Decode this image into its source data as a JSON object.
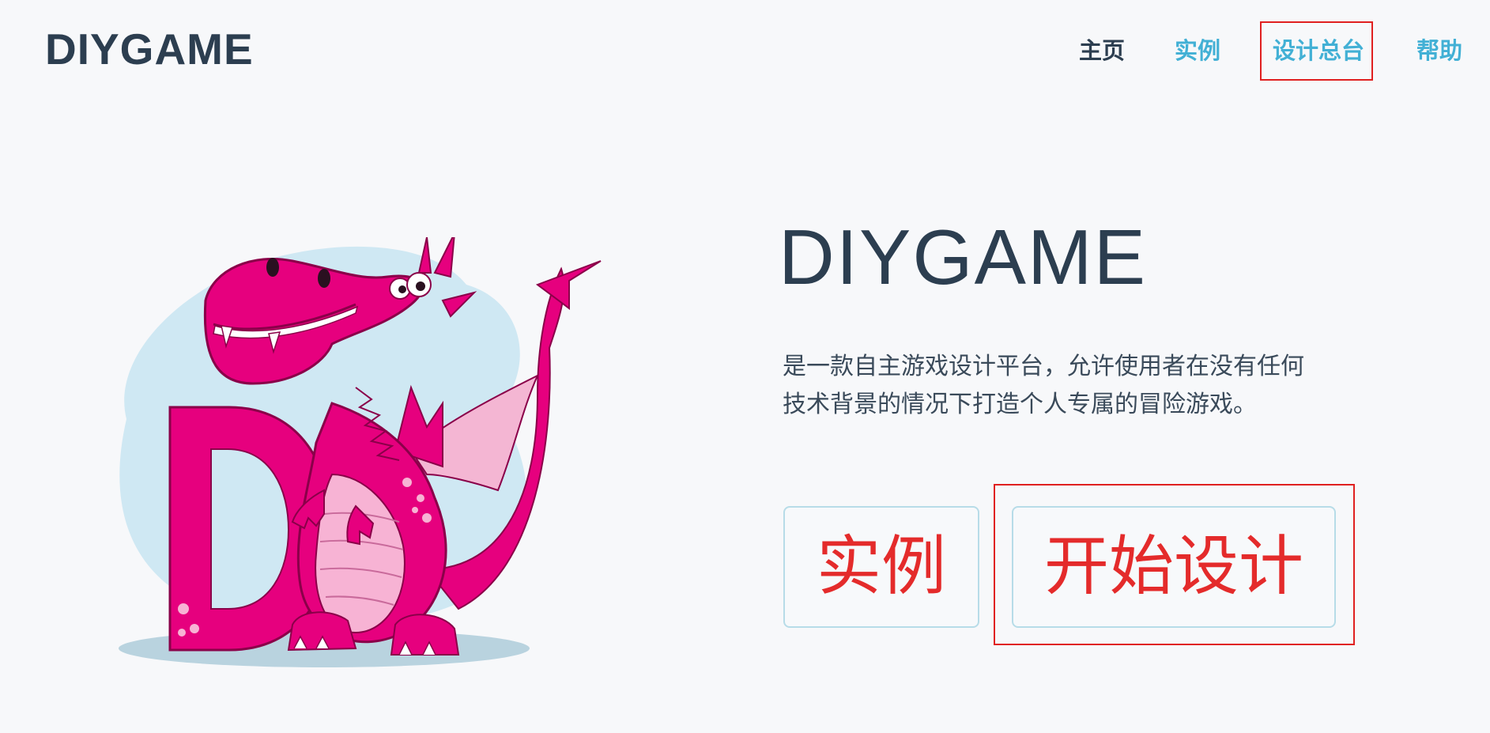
{
  "header": {
    "logo": "DIYGAME",
    "nav": [
      {
        "label": "主页"
      },
      {
        "label": "实例"
      },
      {
        "label": "设计总台"
      },
      {
        "label": "帮助"
      }
    ]
  },
  "hero": {
    "title": "DIYGAME",
    "description_line1": "是一款自主游戏设计平台，允许使用者在没有任何",
    "description_line2": "技术背景的情况下打造个人专属的冒险游戏。",
    "buttons": {
      "examples": "实例",
      "start_design": "开始设计"
    }
  },
  "colors": {
    "text_dark": "#2c3e50",
    "link": "#42b0d5",
    "button_text": "#e42b2b",
    "highlight": "#e02020",
    "dragon": "#e6007e",
    "dragon_light": "#f7b3d4",
    "backdrop": "#cfe8f3"
  }
}
